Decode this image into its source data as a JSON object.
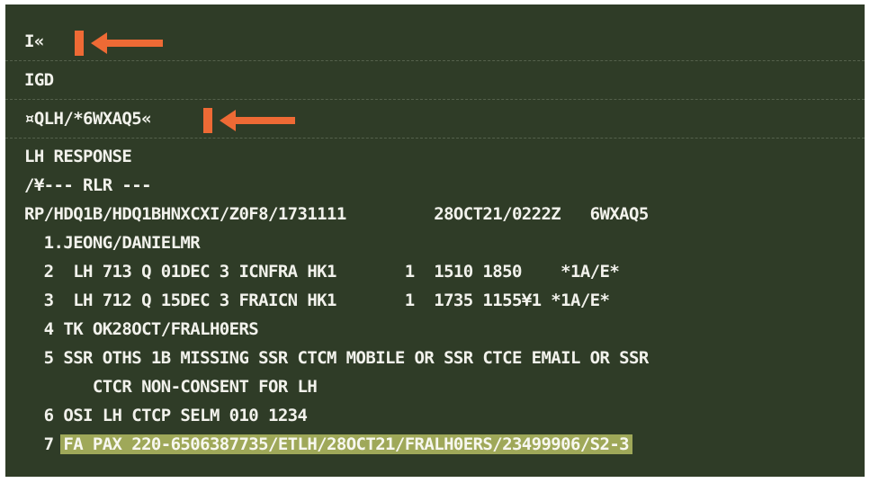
{
  "commands": [
    {
      "text": "I«",
      "has_cursor": true
    },
    {
      "text": "IGD",
      "has_cursor": false
    },
    {
      "text": "¤QLH/*6WXAQ5«",
      "has_cursor": true
    }
  ],
  "response": {
    "header": "LH RESPONSE",
    "rlr": "/¥--- RLR ---",
    "record_line": "RP/HDQ1B/HDQ1BHNXCXI/Z0F8/1731111         28OCT21/0222Z   6WXAQ5",
    "lines": [
      "  1.JEONG/DANIELMR",
      "  2  LH 713 Q 01DEC 3 ICNFRA HK1       1  1510 1850    *1A/E*",
      "  3  LH 712 Q 15DEC 3 FRAICN HK1       1  1735 1155¥1 *1A/E*",
      "  4 TK OK28OCT/FRALH0ERS",
      "  5 SSR OTHS 1B MISSING SSR CTCM MOBILE OR SSR CTCE EMAIL OR SSR",
      "       CTCR NON-CONSENT FOR LH",
      "  6 OSI LH CTCP SELM 010 1234"
    ],
    "highlighted_number": "  7 ",
    "highlighted_text": "FA PAX 220-6506387735/ETLH/28OCT21/FRALH0ERS/23499906/S2-3"
  },
  "colors": {
    "background": "#2f3c27",
    "text": "#f2f2ec",
    "arrow": "#ee6a35",
    "highlight": "#9fa859"
  }
}
